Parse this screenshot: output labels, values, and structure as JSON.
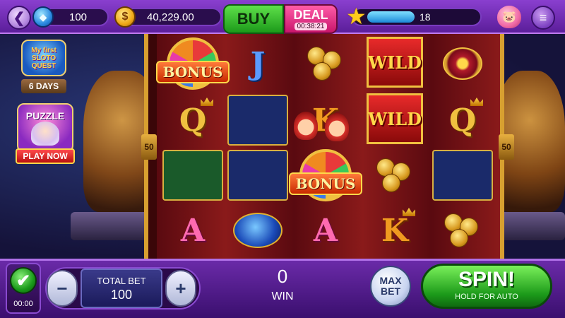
{
  "topbar": {
    "gems": "100",
    "coins": "40,229.00",
    "buy_label": "BUY",
    "deal_label": "DEAL",
    "deal_timer": "00:38:21",
    "level": "18",
    "xp_progress": 0.42
  },
  "promos": {
    "sloto_quest_title": "My first SLOTO QUEST",
    "sloto_quest_days": "6 DAYS",
    "puzzle_title": "PUZZLE",
    "puzzle_cta": "PLAY NOW"
  },
  "reels": {
    "payline_left": "50",
    "payline_right": "50",
    "wild_label": "WILD",
    "bonus_label": "BONUS",
    "symbols": {
      "q": "Q",
      "j": "J",
      "k": "K",
      "a": "A"
    }
  },
  "bottom": {
    "auto_timer": "00:00",
    "minus_label": "−",
    "plus_label": "+",
    "total_bet_label": "TOTAL BET",
    "total_bet_value": "100",
    "win_value": "0",
    "win_label": "WIN",
    "max_bet_line1": "MAX",
    "max_bet_line2": "BET",
    "spin_label": "SPIN!",
    "spin_sub": "HOLD FOR AUTO"
  },
  "icons": {
    "back": "back-arrow-icon",
    "gem": "gem-icon",
    "coin": "coin-icon",
    "star": "star-icon",
    "piggy": "piggy-bank-icon",
    "menu": "menu-icon",
    "check": "checkmark-icon"
  },
  "colors": {
    "topbar": "#8a3fcf",
    "buy": "#1c9a1a",
    "deal": "#c8156b",
    "spin": "#1c9a1a"
  }
}
